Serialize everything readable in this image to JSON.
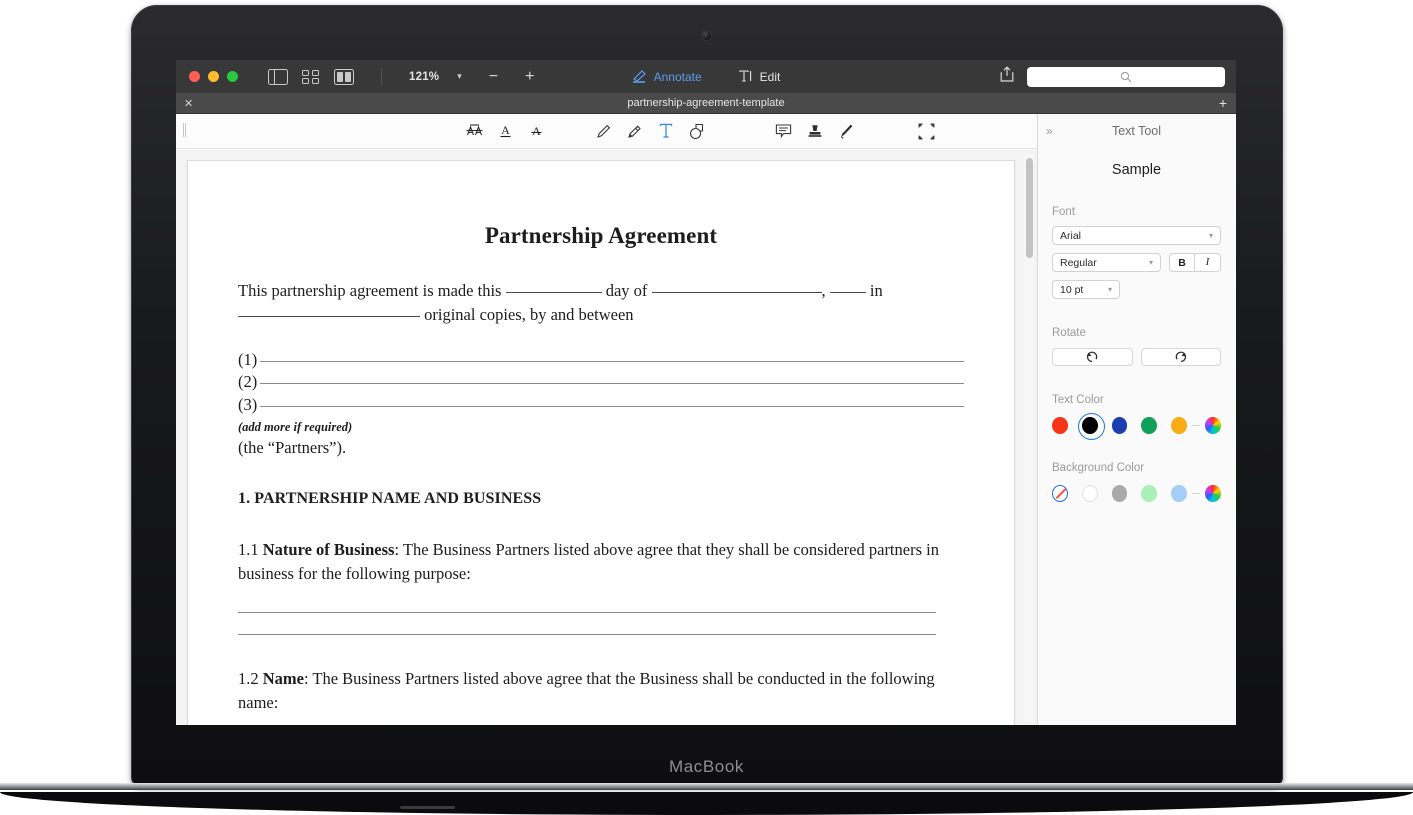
{
  "device": {
    "brand": "MacBook"
  },
  "titlebar": {
    "zoom_level": "121%",
    "zoom_out_label": "−",
    "zoom_in_label": "+",
    "annotate_label": "Annotate",
    "edit_label": "Edit",
    "search_placeholder": "",
    "icons": {
      "sidebar": "sidebar-toggle-icon",
      "grid": "grid-view-icon",
      "twopage": "two-page-view-icon",
      "share": "share-icon",
      "search": "search-icon"
    }
  },
  "tabbar": {
    "close_label": "✕",
    "tab_title": "partnership-agreement-template",
    "new_tab_label": "+"
  },
  "annotation_toolbar": {
    "tools": [
      {
        "name": "text-recognition-icon",
        "glyph": "translate"
      },
      {
        "name": "underline-text-icon",
        "glyph": "A-underline"
      },
      {
        "name": "strikethrough-text-icon",
        "glyph": "A-strike"
      },
      {
        "name": "pencil-icon",
        "glyph": "pencil"
      },
      {
        "name": "eraser-icon",
        "glyph": "eraser"
      },
      {
        "name": "text-tool-icon",
        "glyph": "T",
        "active": true
      },
      {
        "name": "shape-tool-icon",
        "glyph": "shape"
      },
      {
        "name": "note-comment-icon",
        "glyph": "note"
      },
      {
        "name": "stamp-icon",
        "glyph": "stamp"
      },
      {
        "name": "signature-icon",
        "glyph": "pen"
      },
      {
        "name": "select-area-icon",
        "glyph": "crop"
      }
    ]
  },
  "document": {
    "title": "Partnership Agreement",
    "intro_part1": "This partnership agreement is made this",
    "intro_part2": "day of",
    "intro_part3": ",",
    "intro_part4": "in",
    "intro_part5": "original copies, by and between",
    "parties": [
      "(1)",
      "(2)",
      "(3)"
    ],
    "add_more_note": "(add more if required)",
    "partners_line": "(the “Partners”).",
    "section1_heading": "1. PARTNERSHIP NAME AND BUSINESS",
    "clause_1_1_number": "1.1",
    "clause_1_1_term": "Nature of Business",
    "clause_1_1_text": ": The Business Partners listed above agree that they shall be considered partners in business for the following purpose:",
    "clause_1_2_number": "1.2",
    "clause_1_2_term": "Name",
    "clause_1_2_text": ": The Business Partners listed above agree that the Business shall be conducted in the following name:"
  },
  "right_panel": {
    "collapse_label": "»",
    "title": "Text Tool",
    "sample_text": "Sample",
    "font_label": "Font",
    "font_family": "Arial",
    "font_style": "Regular",
    "bold_label": "B",
    "italic_label": "I",
    "font_size": "10 pt",
    "rotate_label": "Rotate",
    "rotate_left_icon": "rotate-counterclockwise-icon",
    "rotate_right_icon": "rotate-clockwise-icon",
    "text_color_label": "Text Color",
    "text_colors": [
      {
        "name": "red",
        "hex": "#f5341a",
        "selected": false
      },
      {
        "name": "black",
        "hex": "#000000",
        "selected": true
      },
      {
        "name": "blue",
        "hex": "#1b3fb0",
        "selected": false
      },
      {
        "name": "green",
        "hex": "#0ea05a",
        "selected": false
      },
      {
        "name": "orange",
        "hex": "#f9ab16",
        "selected": false
      },
      {
        "name": "custom-color-wheel",
        "hex": "wheel",
        "selected": false
      }
    ],
    "background_color_label": "Background Color",
    "background_colors": [
      {
        "name": "none",
        "hex": "none",
        "selected": true
      },
      {
        "name": "white",
        "hex": "#ffffff",
        "selected": false
      },
      {
        "name": "gray",
        "hex": "#aaaaaa",
        "selected": false
      },
      {
        "name": "light-green",
        "hex": "#abefb8",
        "selected": false
      },
      {
        "name": "light-blue",
        "hex": "#a6cdf5",
        "selected": false
      },
      {
        "name": "custom-color-wheel",
        "hex": "wheel",
        "selected": false
      }
    ]
  }
}
